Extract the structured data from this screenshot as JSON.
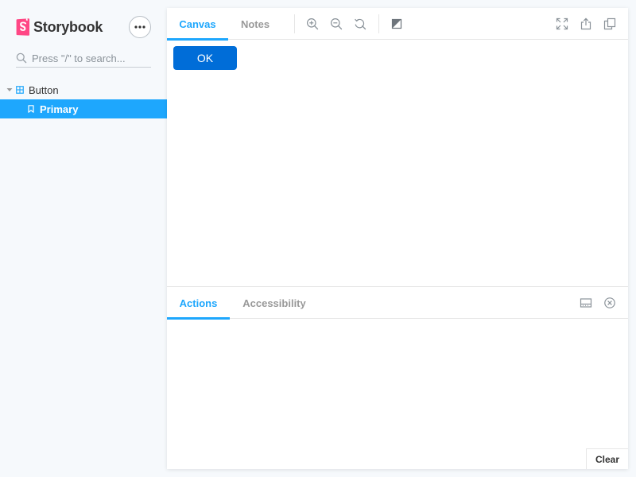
{
  "colors": {
    "accent": "#1ea7fd",
    "brand": "#ff4785",
    "ok_button": "#006dd8",
    "background": "#f6f9fc"
  },
  "sidebar": {
    "brand": {
      "name": "Storybook",
      "logo_icon": "storybook-logo-icon"
    },
    "menu_icon": "ellipsis-icon",
    "search": {
      "placeholder": "Press \"/\" to search...",
      "value": "",
      "icon": "search-icon"
    },
    "tree": {
      "group_label": "Button",
      "group_icon": "component-icon",
      "stories": [
        {
          "label": "Primary",
          "selected": true,
          "icon": "bookmark-icon"
        }
      ]
    }
  },
  "toolbar": {
    "tabs": [
      {
        "label": "Canvas",
        "active": true
      },
      {
        "label": "Notes",
        "active": false
      }
    ],
    "tools": [
      "zoom-in-icon",
      "zoom-out-icon",
      "reset-zoom-icon",
      "background-icon"
    ],
    "right_tools": [
      "fullscreen-icon",
      "share-icon",
      "copy-icon"
    ]
  },
  "canvas": {
    "button_label": "OK"
  },
  "addons": {
    "tabs": [
      {
        "label": "Actions",
        "active": true
      },
      {
        "label": "Accessibility",
        "active": false
      }
    ],
    "tools": [
      "panel-orientation-icon",
      "close-icon"
    ],
    "clear_label": "Clear"
  }
}
